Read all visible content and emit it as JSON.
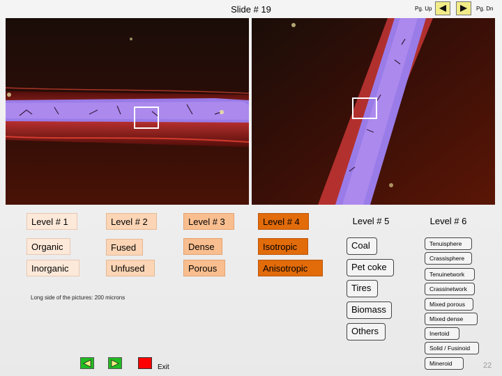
{
  "slide": {
    "title": "Slide # 19",
    "page_number": "22"
  },
  "nav": {
    "pgup_label": "Pg. Up",
    "pgdn_label": "Pg. Dn"
  },
  "levels": [
    {
      "header": "Level # 1",
      "items": [
        "Organic",
        "Inorganic"
      ]
    },
    {
      "header": "Level # 2",
      "items": [
        "Fused",
        "Unfused"
      ]
    },
    {
      "header": "Level # 3",
      "items": [
        "Dense",
        "Porous"
      ]
    },
    {
      "header": "Level # 4",
      "items": [
        "Isotropic",
        "Anisotropic"
      ]
    },
    {
      "header": "Level # 5",
      "items": [
        "Coal",
        "Pet coke",
        "Tires",
        "Biomass",
        "Others"
      ]
    },
    {
      "header": "Level # 6",
      "items": [
        "Tenuisphere",
        "Crassisphere",
        "Tenuinetwork",
        "Crassinetwork",
        "Mixed porous",
        "Mixed dense",
        "Inertoid",
        "Solid / Fusinoid",
        "Mineroid"
      ]
    }
  ],
  "note": "Long side of the pictures: 200 microns",
  "footer": {
    "exit_label": "Exit"
  },
  "colors": {
    "level1": "#fde9d9",
    "level2": "#fbd5b5",
    "level3": "#f9be8f",
    "level4": "#e26b0a",
    "nav_yellow": "#f2ec88",
    "exit_red": "#ff0000"
  }
}
